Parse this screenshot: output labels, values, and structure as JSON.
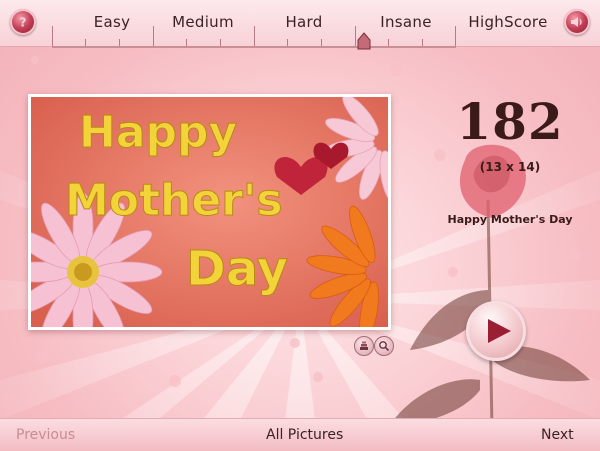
{
  "header": {
    "tabs": [
      {
        "label": "Easy"
      },
      {
        "label": "Medium"
      },
      {
        "label": "Hard"
      },
      {
        "label": "Insane"
      },
      {
        "label": "HighScore"
      }
    ],
    "selected_level": "Insane",
    "left_icon": "help-icon",
    "right_icon": "sound-icon"
  },
  "puzzle": {
    "picture_text": {
      "line1": "Happy",
      "line2": "Mother's",
      "line3": "Day"
    },
    "tools": [
      "layers-icon",
      "zoom-icon"
    ]
  },
  "info": {
    "score": "182",
    "dimensions": "(13 x 14)",
    "title": "Happy Mother's Day"
  },
  "footer": {
    "previous": "Previous",
    "all_pictures": "All Pictures",
    "next": "Next"
  },
  "colors": {
    "accent": "#c24057",
    "text_dark": "#3a2226",
    "disabled": "#c98c95"
  }
}
